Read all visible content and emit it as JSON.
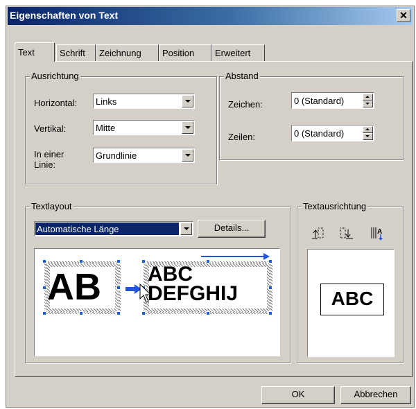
{
  "window": {
    "title": "Eigenschaften von Text",
    "close_symbol": "✕"
  },
  "tabs": [
    {
      "label": "Text",
      "active": true
    },
    {
      "label": "Schrift",
      "active": false
    },
    {
      "label": "Zeichnung",
      "active": false
    },
    {
      "label": "Position",
      "active": false
    },
    {
      "label": "Erweitert",
      "active": false
    }
  ],
  "ausrichtung": {
    "legend": "Ausrichtung",
    "horizontal": {
      "label": "Horizontal:",
      "value": "Links"
    },
    "vertikal": {
      "label": "Vertikal:",
      "value": "Mitte"
    },
    "in_einer_linie": {
      "label_line1": "In einer",
      "label_line2": "Linie:",
      "value": "Grundlinie"
    }
  },
  "abstand": {
    "legend": "Abstand",
    "zeichen": {
      "label": "Zeichen:",
      "value": "0 (Standard)"
    },
    "zeilen": {
      "label": "Zeilen:",
      "value": "0 (Standard)"
    }
  },
  "textlayout": {
    "legend": "Textlayout",
    "mode": "Automatische Länge",
    "details_label": "Details...",
    "preview_left": "AB",
    "preview_right_line1": "ABC",
    "preview_right_line2": "DEFGHIJ"
  },
  "textausrichtung": {
    "legend": "Textausrichtung",
    "icons": [
      "rotate-left-icon",
      "rotate-right-icon",
      "vertical-text-icon"
    ],
    "preview_text": "ABC"
  },
  "buttons": {
    "ok": "OK",
    "cancel": "Abbrechen"
  },
  "colors": {
    "title_start": "#0a246a",
    "title_end": "#a6caf0",
    "selection": "#0a246a",
    "handle": "#1c5fd6",
    "arrow": "#2255dd"
  }
}
